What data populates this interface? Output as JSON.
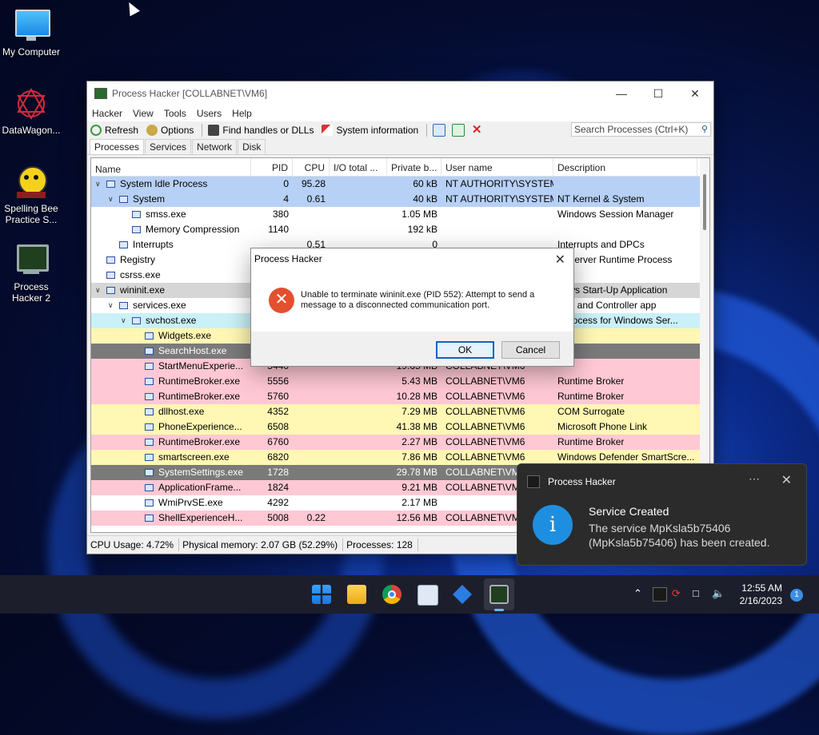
{
  "desktop": {
    "icons": [
      {
        "label": "My Computer"
      },
      {
        "label": "DataWagon..."
      },
      {
        "label": "Spelling Bee Practice S..."
      },
      {
        "label": "Process Hacker 2"
      }
    ]
  },
  "window": {
    "title": "Process Hacker [COLLABNET\\VM6]",
    "menu": [
      "Hacker",
      "View",
      "Tools",
      "Users",
      "Help"
    ],
    "toolbar": {
      "refresh": "Refresh",
      "options": "Options",
      "find_handles": "Find handles or DLLs",
      "system_info": "System information",
      "search_placeholder": "Search Processes (Ctrl+K)"
    },
    "tabs": [
      "Processes",
      "Services",
      "Network",
      "Disk"
    ],
    "columns": [
      "Name",
      "PID",
      "CPU",
      "I/O total ...",
      "Private b...",
      "User name",
      "Description"
    ],
    "rows": [
      {
        "indent": 0,
        "expander": "v",
        "name": "System Idle Process",
        "pid": "0",
        "cpu": "95.28",
        "io": "",
        "priv": "60 kB",
        "user": "NT AUTHORITY\\SYSTEM",
        "desc": "",
        "color": "#b7d0f5"
      },
      {
        "indent": 1,
        "expander": "v",
        "name": "System",
        "pid": "4",
        "cpu": "0.61",
        "io": "",
        "priv": "40 kB",
        "user": "NT AUTHORITY\\SYSTEM",
        "desc": "NT Kernel & System",
        "color": "#b7d0f5"
      },
      {
        "indent": 2,
        "expander": "",
        "name": "smss.exe",
        "pid": "380",
        "cpu": "",
        "io": "",
        "priv": "1.05 MB",
        "user": "",
        "desc": "Windows Session Manager",
        "color": "#ffffff"
      },
      {
        "indent": 2,
        "expander": "",
        "name": "Memory Compression",
        "pid": "1140",
        "cpu": "",
        "io": "",
        "priv": "192 kB",
        "user": "",
        "desc": "",
        "color": "#ffffff"
      },
      {
        "indent": 1,
        "expander": "",
        "name": "Interrupts",
        "pid": "",
        "cpu": "0.51",
        "io": "",
        "priv": "0",
        "user": "",
        "desc": "Interrupts and DPCs",
        "color": "#ffffff"
      },
      {
        "indent": 0,
        "expander": "",
        "name": "Registry",
        "pid": "",
        "cpu": "",
        "io": "",
        "priv": "",
        "user": "",
        "desc": "nt Server Runtime Process",
        "color": "#ffffff"
      },
      {
        "indent": 0,
        "expander": "",
        "name": "csrss.exe",
        "pid": "",
        "cpu": "",
        "io": "",
        "priv": "",
        "user": "",
        "desc": "",
        "color": "#ffffff"
      },
      {
        "indent": 0,
        "expander": "v",
        "name": "wininit.exe",
        "pid": "",
        "cpu": "",
        "io": "",
        "priv": "",
        "user": "",
        "desc": "dows Start-Up Application",
        "color": "#d6d6d6"
      },
      {
        "indent": 1,
        "expander": "v",
        "name": "services.exe",
        "pid": "",
        "cpu": "",
        "io": "",
        "priv": "",
        "user": "",
        "desc": "ices and Controller app",
        "color": "#ffffff"
      },
      {
        "indent": 2,
        "expander": "v",
        "name": "svchost.exe",
        "pid": "",
        "cpu": "",
        "io": "",
        "priv": "",
        "user": "",
        "desc": "t Process for Windows Ser...",
        "color": "#c9f1f7"
      },
      {
        "indent": 3,
        "expander": "",
        "name": "Widgets.exe",
        "pid": "",
        "cpu": "",
        "io": "",
        "priv": "",
        "user": "",
        "desc": "",
        "color": "#fff7b3"
      },
      {
        "indent": 3,
        "expander": "",
        "name": "SearchHost.exe",
        "pid": "",
        "cpu": "",
        "io": "",
        "priv": "",
        "user": "",
        "desc": "",
        "color": "#7a7a7a"
      },
      {
        "indent": 3,
        "expander": "",
        "name": "StartMenuExperie...",
        "pid": "5440",
        "cpu": "",
        "io": "",
        "priv": "19.65 MB",
        "user": "COLLABNET\\VM6",
        "desc": "",
        "color": "#ffc8d4"
      },
      {
        "indent": 3,
        "expander": "",
        "name": "RuntimeBroker.exe",
        "pid": "5556",
        "cpu": "",
        "io": "",
        "priv": "5.43 MB",
        "user": "COLLABNET\\VM6",
        "desc": "Runtime Broker",
        "color": "#ffc8d4"
      },
      {
        "indent": 3,
        "expander": "",
        "name": "RuntimeBroker.exe",
        "pid": "5760",
        "cpu": "",
        "io": "",
        "priv": "10.28 MB",
        "user": "COLLABNET\\VM6",
        "desc": "Runtime Broker",
        "color": "#ffc8d4"
      },
      {
        "indent": 3,
        "expander": "",
        "name": "dllhost.exe",
        "pid": "4352",
        "cpu": "",
        "io": "",
        "priv": "7.29 MB",
        "user": "COLLABNET\\VM6",
        "desc": "COM Surrogate",
        "color": "#fff7b3"
      },
      {
        "indent": 3,
        "expander": "",
        "name": "PhoneExperience...",
        "pid": "6508",
        "cpu": "",
        "io": "",
        "priv": "41.38 MB",
        "user": "COLLABNET\\VM6",
        "desc": "Microsoft Phone Link",
        "color": "#fff7b3"
      },
      {
        "indent": 3,
        "expander": "",
        "name": "RuntimeBroker.exe",
        "pid": "6760",
        "cpu": "",
        "io": "",
        "priv": "2.27 MB",
        "user": "COLLABNET\\VM6",
        "desc": "Runtime Broker",
        "color": "#ffc8d4"
      },
      {
        "indent": 3,
        "expander": "",
        "name": "smartscreen.exe",
        "pid": "6820",
        "cpu": "",
        "io": "",
        "priv": "7.86 MB",
        "user": "COLLABNET\\VM6",
        "desc": "Windows Defender SmartScre...",
        "color": "#fff7b3"
      },
      {
        "indent": 3,
        "expander": "",
        "name": "SystemSettings.exe",
        "pid": "1728",
        "cpu": "",
        "io": "",
        "priv": "29.78 MB",
        "user": "COLLABNET\\VM6",
        "desc": "",
        "color": "#7a7a7a"
      },
      {
        "indent": 3,
        "expander": "",
        "name": "ApplicationFrame...",
        "pid": "1824",
        "cpu": "",
        "io": "",
        "priv": "9.21 MB",
        "user": "COLLABNET\\VM6",
        "desc": "",
        "color": "#ffc8d4"
      },
      {
        "indent": 3,
        "expander": "",
        "name": "WmiPrvSE.exe",
        "pid": "4292",
        "cpu": "",
        "io": "",
        "priv": "2.17 MB",
        "user": "",
        "desc": "",
        "color": "#ffffff"
      },
      {
        "indent": 3,
        "expander": "",
        "name": "ShellExperienceH...",
        "pid": "5008",
        "cpu": "0.22",
        "io": "",
        "priv": "12.56 MB",
        "user": "COLLABNET\\VM6",
        "desc": "",
        "color": "#ffc8d4"
      }
    ],
    "status": {
      "cpu": "CPU Usage: 4.72%",
      "memory": "Physical memory: 2.07 GB (52.29%)",
      "processes": "Processes: 128"
    }
  },
  "dialog": {
    "title": "Process Hacker",
    "message": "Unable to terminate wininit.exe (PID 552): Attempt to send a message to a disconnected communication port.",
    "ok": "OK",
    "cancel": "Cancel"
  },
  "toast": {
    "app": "Process Hacker",
    "title": "Service Created",
    "body": "The service MpKsla5b75406 (MpKsla5b75406) has been created."
  },
  "taskbar": {
    "time": "12:55 AM",
    "date": "2/16/2023",
    "notification_count": "1"
  }
}
